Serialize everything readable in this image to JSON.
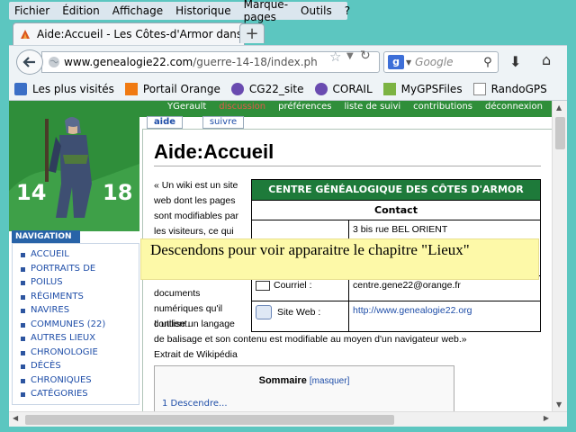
{
  "menubar": {
    "items": [
      {
        "label": "Fichier"
      },
      {
        "label": "Édition"
      },
      {
        "label": "Affichage"
      },
      {
        "label": "Historique"
      },
      {
        "label": "Marque-pages"
      },
      {
        "label": "Outils"
      },
      {
        "label": "?"
      }
    ]
  },
  "tab": {
    "title": "Aide:Accueil - Les Côtes-d'Armor dans l...",
    "newtab_label": "+"
  },
  "navbar": {
    "url_domain": "www.genealogie22.com",
    "url_path": "/guerre-14-18/index.php/Aide",
    "search_placeholder": "Google",
    "search_engine": "g"
  },
  "bookmarks": [
    {
      "label": "Les plus visités",
      "icon": "bookmarks-icon",
      "color": "#3b6fc6"
    },
    {
      "label": "Portail Orange",
      "icon": "orange-icon",
      "color": "#f07a12"
    },
    {
      "label": "CG22_site",
      "icon": "cg22-icon",
      "color": "#6a4bb0"
    },
    {
      "label": "CORAIL",
      "icon": "corail-icon",
      "color": "#6a4bb0"
    },
    {
      "label": "MyGPSFiles",
      "icon": "mygps-icon",
      "color": "#7cb342"
    },
    {
      "label": "RandoGPS",
      "icon": "page-icon",
      "color": "#888888"
    }
  ],
  "wiki": {
    "logo_text_left": "14",
    "logo_text_right": "18",
    "nav_heading": "NAVIGATION",
    "nav_items": [
      {
        "label": "ACCUEIL"
      },
      {
        "label": "PORTRAITS DE"
      },
      {
        "label": "POILUS"
      },
      {
        "label": "RÉGIMENTS"
      },
      {
        "label": "NAVIRES"
      },
      {
        "label": "COMMUNES (22)"
      },
      {
        "label": "AUTRES LIEUX"
      },
      {
        "label": "CHRONOLOGIE"
      },
      {
        "label": "DÉCÈS"
      },
      {
        "label": "CHRONIQUES"
      },
      {
        "label": "CATÉGORIES"
      }
    ],
    "personal": {
      "user": "YGerault",
      "discussion": "discussion",
      "preferences": "préférences",
      "watchlist": "liste de suivi",
      "contributions": "contributions",
      "logout": "déconnexion"
    },
    "page_tabs": {
      "aide": "aide",
      "suivre": "suivre"
    },
    "title": "Aide:Accueil",
    "intro_lines": [
      "« Un wiki est un site",
      "web dont les pages",
      "sont modifiables par",
      "les visiteurs, ce qui"
    ],
    "intro2_lines": [
      "documents",
      "numériques qu'il",
      "contient."
    ],
    "intro3_lines": [
      "Il utilise un langage",
      "de balisage et son contenu est modifiable au moyen d'un navigateur web.»",
      "Extrait de Wikipédia"
    ],
    "infobox": {
      "heading": "CENTRE GÉNÉALOGIQUE DES CÔTES D'ARMOR",
      "sub_heading": "Contact",
      "address_value": "3 bis rue BEL ORIENT",
      "email_label": "Courriel :",
      "email_value": "centre.gene22@orange.fr",
      "site_label": "Site Web :",
      "site_value": "http://www.genealogie22.org"
    },
    "sommaire": {
      "title": "Sommaire",
      "toggle": "[masquer]",
      "first_item": "1 Descendre..."
    }
  },
  "overlay": {
    "text": "Descendons pour voir apparaitre le chapitre \"Lieux\""
  },
  "colors": {
    "desktop": "#5cc6c0",
    "wiki_green": "#2f8e3a",
    "infobox_green": "#1e7a3a",
    "link_blue": "#1f4ea8",
    "nav_head_blue": "#2863a8",
    "overlay_yellow": "#fdf9a8"
  }
}
